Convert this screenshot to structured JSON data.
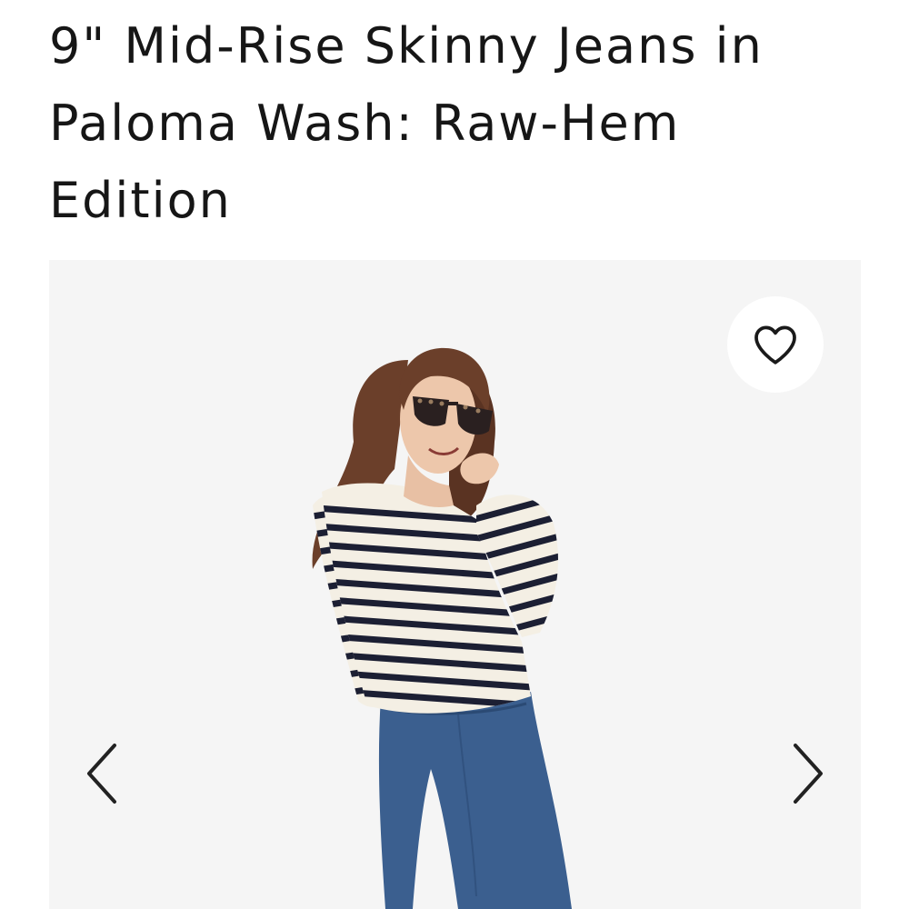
{
  "product": {
    "title": "9\" Mid-Rise Skinny Jeans in Paloma Wash: Raw-Hem Edition"
  },
  "gallery": {
    "image_subject": "model-photo",
    "wishlist_icon": "heart-icon",
    "prev_icon": "chevron-left-icon",
    "next_icon": "chevron-right-icon"
  },
  "colors": {
    "background": "#ffffff",
    "gallery_background": "#f5f5f5",
    "text": "#161616",
    "stripe_navy": "#1c1f33",
    "stripe_cream": "#f4efe4",
    "denim": "#3b5f8f",
    "hair": "#6b3f2a"
  }
}
